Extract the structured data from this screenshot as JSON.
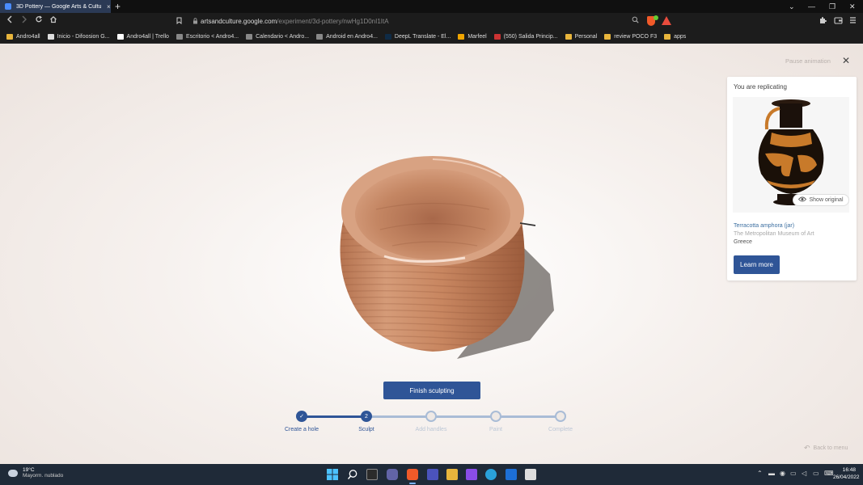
{
  "browser": {
    "tab_title": "3D Pottery — Google Arts & Cultu",
    "tab_close": "×",
    "new_tab": "+",
    "url_host": "artsandculture.google.com",
    "url_path": "/experiment/3d-pottery/nwHg1D0nI1ItA",
    "window_min": "—",
    "window_restore": "❐",
    "window_close": "✕",
    "tab_menu": "⌄",
    "brave_badge_count": "",
    "bookmarks": [
      {
        "label": "Andro4all",
        "color": "#e8b53c"
      },
      {
        "label": "Inicio - Difoosion G...",
        "color": "#dddddd"
      },
      {
        "label": "Andro4all | Trello",
        "color": "#ffffff"
      },
      {
        "label": "Escritorio < Andro4...",
        "color": "#888888"
      },
      {
        "label": "Calendario < Andro...",
        "color": "#888888"
      },
      {
        "label": "Android en Andro4...",
        "color": "#888888"
      },
      {
        "label": "DeepL Translate - El...",
        "color": "#0f2b46"
      },
      {
        "label": "Marfeel",
        "color": "#f0a500"
      },
      {
        "label": "(550) Salida Princip...",
        "color": "#cc3333"
      },
      {
        "label": "Personal",
        "color": "#e8b53c"
      },
      {
        "label": "review POCO F3",
        "color": "#e8b53c"
      },
      {
        "label": "apps",
        "color": "#e8b53c"
      }
    ]
  },
  "page": {
    "pause_animation": "Pause animation",
    "close_icon": "✕",
    "finish_button": "Finish sculpting",
    "back_to_menu": "Back to menu",
    "card": {
      "header": "You are replicating",
      "show_original": "Show original",
      "art_title": "Terracotta amphora (jar)",
      "museum": "The Metropolitan Museum of Art",
      "origin": "Greece",
      "learn_more": "Learn more"
    },
    "steps": [
      {
        "label": "Create a hole",
        "marker": "✓",
        "state": "done"
      },
      {
        "label": "Sculpt",
        "marker": "2",
        "state": "current"
      },
      {
        "label": "Add handles",
        "marker": "",
        "state": "todo"
      },
      {
        "label": "Paint",
        "marker": "",
        "state": "todo"
      },
      {
        "label": "Complete",
        "marker": "",
        "state": "todo"
      }
    ],
    "colors": {
      "accent": "#2f5597",
      "clay": "#c98a66",
      "background": "#efe9e5"
    }
  },
  "taskbar": {
    "temperature": "19°C",
    "weather": "Mayorm. nublado",
    "time": "16:48",
    "date": "26/04/2022"
  }
}
